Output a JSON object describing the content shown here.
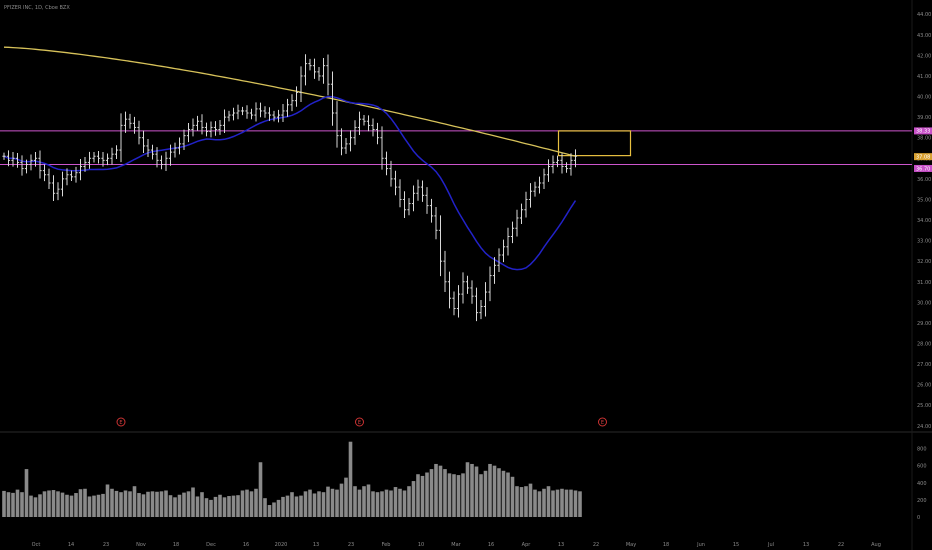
{
  "legend": {
    "title": "PFIZER INC, 1D, Cboe BZX"
  },
  "colors": {
    "background": "#000000",
    "bar": "#d8d8d8",
    "ma_short": "#2222c8",
    "ma_long": "#d7c25a",
    "level": "#cc55cc",
    "target_box": "#e8c040",
    "volume": "#8a8a8a",
    "earnings": "#cc3333",
    "price_badge": "#d8a030"
  },
  "earnings_markers": [
    {
      "label": "E",
      "index": 26
    },
    {
      "label": "E",
      "index": 79
    },
    {
      "label": "E",
      "index": 133
    }
  ],
  "price_badges": [
    {
      "label": "38.33",
      "value": 38.33,
      "color": "#c850c8"
    },
    {
      "label": "37.08",
      "value": 37.08,
      "color": "#d8a030"
    },
    {
      "label": "36.70",
      "value": 36.7,
      "color": "#c850c8"
    }
  ],
  "chart_data": {
    "type": "ohlc",
    "title": "PFIZER INC, 1D, Cboe BZX",
    "price_axis": {
      "ylim": [
        23.7,
        44.4
      ],
      "ticks": [
        "24.00",
        "25.00",
        "26.00",
        "27.00",
        "28.00",
        "29.00",
        "30.00",
        "31.00",
        "32.00",
        "33.00",
        "34.00",
        "35.00",
        "36.00",
        "37.00",
        "38.00",
        "39.00",
        "40.00",
        "41.00",
        "42.00",
        "43.00",
        "44.00"
      ]
    },
    "volume_axis": {
      "ylim": [
        0,
        900
      ],
      "ticks": [
        "0",
        "200",
        "400",
        "600",
        "800"
      ]
    },
    "time_axis_labels": [
      "Oct",
      "14",
      "23",
      "Nov",
      "18",
      "Dec",
      "16",
      "2020",
      "13",
      "23",
      "Feb",
      "10",
      "Mar",
      "16",
      "Apr",
      "13",
      "22",
      "May",
      "18",
      "Jun",
      "15",
      "Jul",
      "13",
      "22",
      "Aug"
    ],
    "close": [
      37.1,
      36.9,
      37.0,
      36.8,
      36.5,
      36.7,
      36.9,
      37.0,
      36.4,
      36.2,
      35.8,
      35.3,
      35.5,
      36.0,
      36.2,
      36.1,
      36.3,
      36.6,
      36.8,
      37.0,
      37.1,
      37.0,
      36.9,
      37.0,
      37.2,
      37.4,
      38.6,
      38.9,
      38.7,
      38.5,
      38.0,
      37.6,
      37.4,
      37.2,
      36.9,
      36.7,
      37.0,
      37.3,
      37.5,
      37.7,
      38.1,
      38.4,
      38.6,
      38.8,
      38.5,
      38.3,
      38.5,
      38.4,
      38.6,
      39.0,
      39.1,
      39.2,
      39.3,
      39.3,
      39.2,
      39.1,
      39.4,
      39.3,
      39.2,
      39.1,
      39.0,
      39.1,
      39.3,
      39.6,
      39.8,
      40.2,
      41.0,
      41.6,
      41.5,
      41.2,
      41.0,
      41.5,
      40.6,
      39.2,
      38.1,
      37.5,
      37.7,
      38.0,
      38.5,
      38.9,
      38.8,
      38.6,
      38.4,
      38.0,
      37.0,
      36.5,
      36.0,
      35.6,
      35.0,
      34.5,
      34.8,
      35.3,
      35.6,
      35.2,
      34.7,
      34.2,
      33.5,
      32.0,
      31.0,
      30.2,
      29.7,
      30.4,
      31.0,
      30.7,
      30.3,
      29.5,
      29.8,
      30.5,
      31.3,
      31.8,
      32.3,
      32.7,
      33.2,
      33.6,
      34.1,
      34.5,
      35.0,
      35.4,
      35.6,
      35.8,
      36.2,
      36.6,
      36.8,
      36.9,
      36.6,
      36.5,
      36.9,
      37.1
    ],
    "volume": [
      305,
      290,
      282,
      320,
      290,
      560,
      250,
      230,
      265,
      300,
      310,
      315,
      300,
      285,
      260,
      250,
      280,
      325,
      330,
      240,
      250,
      260,
      270,
      380,
      330,
      305,
      290,
      310,
      300,
      360,
      280,
      265,
      295,
      300,
      295,
      300,
      310,
      255,
      230,
      260,
      285,
      300,
      345,
      240,
      290,
      220,
      200,
      235,
      260,
      230,
      245,
      250,
      255,
      310,
      320,
      300,
      330,
      640,
      220,
      140,
      170,
      200,
      235,
      250,
      290,
      240,
      250,
      300,
      320,
      275,
      300,
      290,
      355,
      330,
      320,
      390,
      460,
      880,
      360,
      320,
      360,
      380,
      300,
      290,
      300,
      320,
      310,
      350,
      330,
      310,
      360,
      420,
      500,
      480,
      520,
      560,
      620,
      600,
      560,
      510,
      500,
      490,
      510,
      640,
      620,
      590,
      500,
      540,
      620,
      600,
      570,
      540,
      520,
      470,
      360,
      350,
      360,
      390,
      320,
      300,
      330,
      360,
      310,
      320,
      330,
      320,
      320,
      310,
      300
    ]
  }
}
